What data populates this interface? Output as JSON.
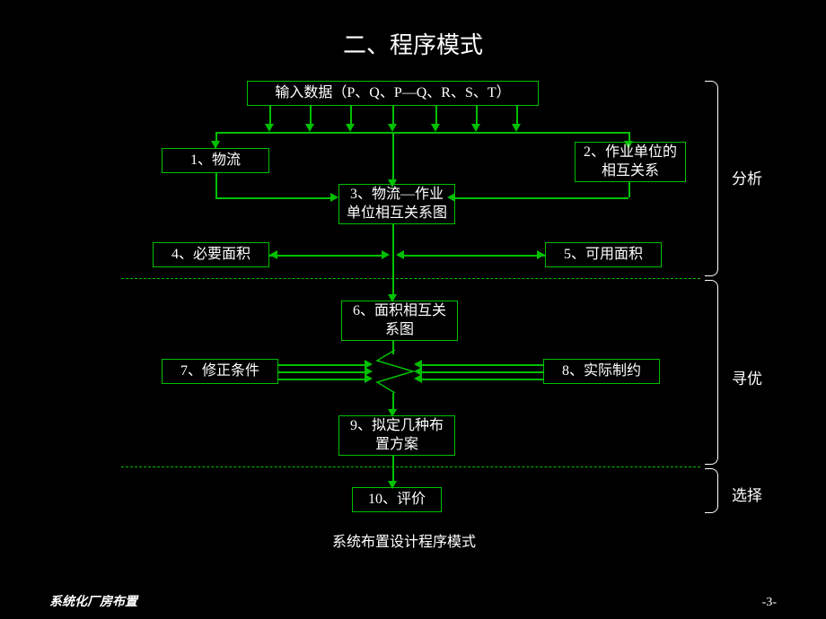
{
  "title": "二、程序模式",
  "boxes": {
    "input": "输入数据（P、Q、P—Q、R、S、T）",
    "b1": "1、物流",
    "b2": "2、作业单位的相互关系",
    "b3": "3、物流—作业单位相互关系图",
    "b4": "4、必要面积",
    "b5": "5、可用面积",
    "b6": "6、面积相互关系图",
    "b7": "7、修正条件",
    "b8": "8、实际制约",
    "b9": "9、拟定几种布置方案",
    "b10": "10、评价"
  },
  "caption": "系统布置设计程序模式",
  "stages": {
    "s1": "分析",
    "s2": "寻优",
    "s3": "选择"
  },
  "footer": {
    "left": "系统化厂房布置",
    "right": "-3-"
  }
}
